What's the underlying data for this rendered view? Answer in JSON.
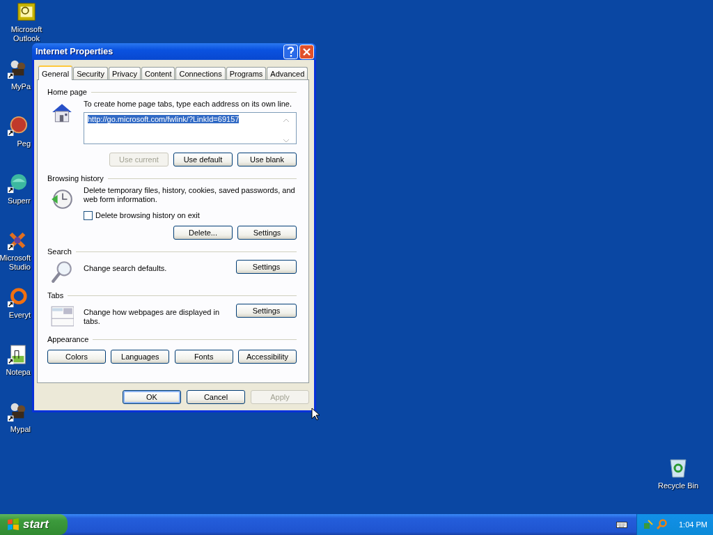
{
  "desktop_icons": [
    {
      "kind": "outlook",
      "lines": [
        "Microsoft",
        "Outlook"
      ]
    },
    {
      "kind": "figure",
      "lines": [
        "MyPa"
      ]
    },
    {
      "kind": "ball",
      "lines": [
        "Peg"
      ]
    },
    {
      "kind": "globe",
      "lines": [
        "Superr"
      ]
    },
    {
      "kind": "studio",
      "lines": [
        "Microsoft",
        "Studio"
      ]
    },
    {
      "kind": "ring",
      "lines": [
        "Everyt"
      ]
    },
    {
      "kind": "notepad",
      "lines": [
        "Notepa"
      ]
    },
    {
      "kind": "figure",
      "lines": [
        "Mypal"
      ]
    }
  ],
  "recycle_bin": {
    "label": "Recycle Bin"
  },
  "window": {
    "title": "Internet Properties"
  },
  "tabs": [
    {
      "label": "General",
      "selected": true
    },
    {
      "label": "Security",
      "selected": false
    },
    {
      "label": "Privacy",
      "selected": false
    },
    {
      "label": "Content",
      "selected": false
    },
    {
      "label": "Connections",
      "selected": false
    },
    {
      "label": "Programs",
      "selected": false
    },
    {
      "label": "Advanced",
      "selected": false
    }
  ],
  "home_page": {
    "title": "Home page",
    "description": "To create home page tabs, type each address on its own line.",
    "url": "http://go.microsoft.com/fwlink/?LinkId=69157",
    "url_selected": true,
    "buttons": [
      {
        "label": "Use current",
        "disabled": true
      },
      {
        "label": "Use default",
        "disabled": false
      },
      {
        "label": "Use blank",
        "disabled": false
      }
    ]
  },
  "browsing_history": {
    "title": "Browsing history",
    "description": "Delete temporary files, history, cookies, saved passwords, and web form information.",
    "checkbox": {
      "label": "Delete browsing history on exit",
      "checked": false
    },
    "buttons": [
      {
        "label": "Delete...",
        "disabled": false
      },
      {
        "label": "Settings",
        "disabled": false
      }
    ]
  },
  "search": {
    "title": "Search",
    "description": "Change search defaults.",
    "buttons": [
      {
        "label": "Settings",
        "disabled": false
      }
    ]
  },
  "tabs_section": {
    "title": "Tabs",
    "description": "Change how webpages are displayed in tabs.",
    "buttons": [
      {
        "label": "Settings",
        "disabled": false
      }
    ]
  },
  "appearance": {
    "title": "Appearance",
    "buttons": [
      {
        "label": "Colors",
        "disabled": false
      },
      {
        "label": "Languages",
        "disabled": false
      },
      {
        "label": "Fonts",
        "disabled": false
      },
      {
        "label": "Accessibility",
        "disabled": false
      }
    ]
  },
  "footer_buttons": [
    {
      "label": "OK",
      "disabled": false,
      "default": true
    },
    {
      "label": "Cancel",
      "disabled": false,
      "default": false
    },
    {
      "label": "Apply",
      "disabled": true,
      "default": false
    }
  ],
  "taskbar": {
    "start": "start",
    "clock": "1:04 PM"
  }
}
